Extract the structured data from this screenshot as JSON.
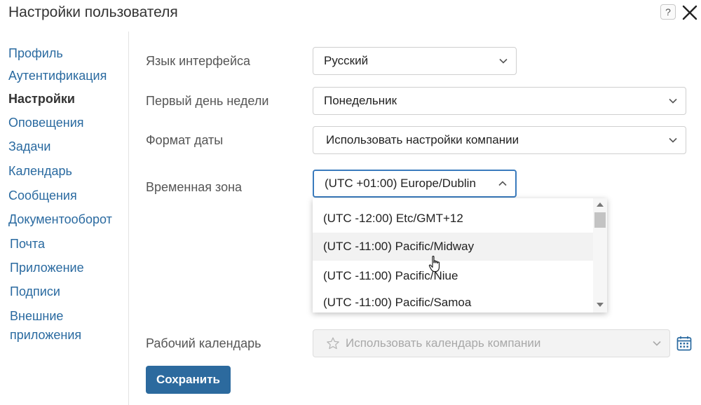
{
  "dialog": {
    "title": "Настройки пользователя",
    "help_label": "?",
    "close_icon": "close-icon"
  },
  "sidebar": {
    "items": [
      {
        "label": "Профиль",
        "active": false
      },
      {
        "label": "Аутентификация",
        "active": false
      },
      {
        "label": "Настройки",
        "active": true
      },
      {
        "label": "Оповещения",
        "active": false
      },
      {
        "label": "Задачи",
        "active": false
      },
      {
        "label": "Календарь",
        "active": false
      },
      {
        "label": "Сообщения",
        "active": false
      },
      {
        "label": "Документооборот",
        "active": false
      },
      {
        "label": "Почта",
        "active": false
      },
      {
        "label": "Приложение",
        "active": false
      },
      {
        "label": "Подписи",
        "active": false
      },
      {
        "label": "Внешние",
        "active": false
      },
      {
        "label": "приложения",
        "active": false
      }
    ]
  },
  "form": {
    "language": {
      "label": "Язык интерфейса",
      "value": "Русский"
    },
    "first_day": {
      "label": "Первый день недели",
      "value": "Понедельник"
    },
    "date_format": {
      "label": "Формат даты",
      "value": "Использовать настройки компании"
    },
    "timezone": {
      "label": "Временная зона",
      "value": "(UTC +01:00) Europe/Dublin",
      "expanded": true,
      "options": [
        "(UTC -12:00) Etc/GMT+12",
        "(UTC -11:00) Pacific/Midway",
        "(UTC -11:00) Pacific/Niue",
        "(UTC -11:00) Pacific/Samoa"
      ],
      "hovered_option": "(UTC -11:00) Pacific/Midway"
    },
    "work_calendar": {
      "label": "Рабочий календарь",
      "placeholder": "Использовать календарь компании",
      "disabled": true,
      "icon": "star-icon",
      "button_icon": "calendar-icon"
    },
    "save_label": "Сохранить"
  },
  "colors": {
    "link": "#2a6aa0",
    "primary_button": "#2c6a9e",
    "focus_border": "#3a7bbd"
  }
}
